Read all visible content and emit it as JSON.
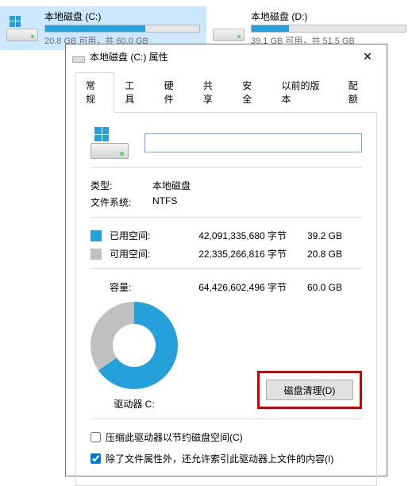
{
  "drives": [
    {
      "name": "本地磁盘 (C:)",
      "free_text": "20.8 GB 可用，共 60.0 GB",
      "fill_pct": 65,
      "selected": true
    },
    {
      "name": "本地磁盘 (D:)",
      "free_text": "39.1 GB 可用，共 51.5 GB",
      "fill_pct": 24,
      "selected": false
    }
  ],
  "dialog": {
    "title": "本地磁盘 (C:) 属性",
    "tabs": [
      "常规",
      "工具",
      "硬件",
      "共享",
      "安全",
      "以前的版本",
      "配额"
    ],
    "active_tab": 0,
    "general": {
      "name_value": "",
      "type_label": "类型:",
      "type_value": "本地磁盘",
      "fs_label": "文件系统:",
      "fs_value": "NTFS",
      "used_label": "已用空间:",
      "used_bytes": "42,091,335,680 字节",
      "used_gb": "39.2 GB",
      "free_label": "可用空间:",
      "free_bytes": "22,335,266,816 字节",
      "free_gb": "20.8 GB",
      "capacity_label": "容量:",
      "capacity_bytes": "64,426,602,496 字节",
      "capacity_gb": "60.0 GB",
      "drive_label": "驱动器 C:",
      "cleanup_button": "磁盘清理(D)",
      "compress_check": "压缩此驱动器以节约磁盘空间(C)",
      "index_check": "除了文件属性外，还允许索引此驱动器上文件的内容(I)",
      "compress_checked": false,
      "index_checked": true,
      "used_fraction_deg": 235
    }
  }
}
